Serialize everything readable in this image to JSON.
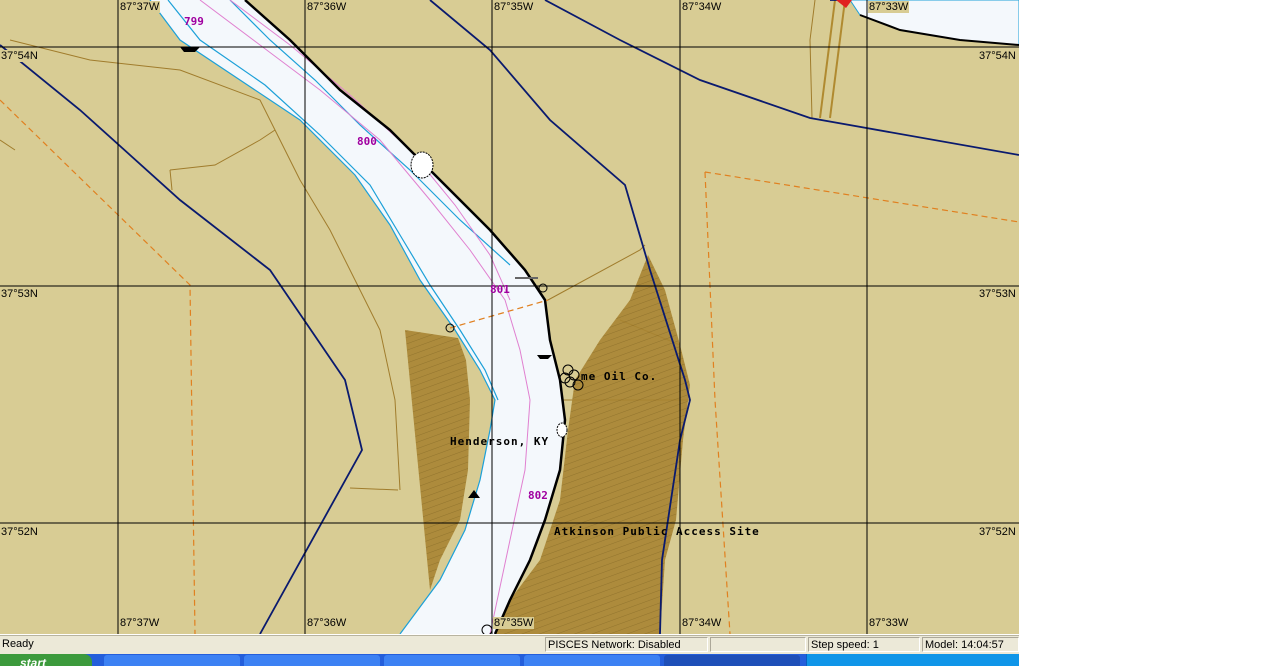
{
  "map": {
    "longitude_labels": [
      "87°37W",
      "87°36W",
      "87°35W",
      "87°34W",
      "87°33W"
    ],
    "latitude_labels": [
      "37°54N",
      "37°53N",
      "37°52N"
    ],
    "river_miles": [
      "799",
      "800",
      "801",
      "802"
    ],
    "places": {
      "oil_company": "me Oil Co.",
      "city": "Henderson, KY",
      "access_site": "Atkinson Public Access Site"
    },
    "colors": {
      "land": "#d8cc94",
      "water": "#f4f8fc",
      "channel_edge": "#1ca0d8",
      "boundary": "#0a1a6e",
      "grid": "#000000",
      "shaded_area": "#a07c2c",
      "orange_dashed": "#e08020",
      "mile_marker": "#a000a0"
    }
  },
  "status_bar": {
    "ready": "Ready",
    "network": "PISCES Network: Disabled",
    "empty_pane": "",
    "step_speed": "Step speed: 1",
    "model_time": "Model: 14:04:57"
  },
  "taskbar": {
    "start_label": "start"
  }
}
